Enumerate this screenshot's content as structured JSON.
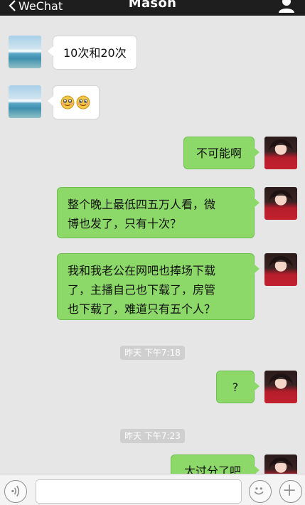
{
  "header": {
    "back_label": "WeChat",
    "title": "Mason",
    "bg_color": "#1e1e1e"
  },
  "messages": [
    {
      "side": "left",
      "avatar": "sea-avatar",
      "text": "10次和20次"
    },
    {
      "side": "left",
      "avatar": "sea-avatar",
      "text": "",
      "emoji": [
        "smiling-face-emoji",
        "smiling-face-emoji"
      ]
    },
    {
      "side": "right",
      "avatar": "girl-avatar",
      "text": "不可能啊"
    },
    {
      "side": "right",
      "avatar": "girl-avatar",
      "lines": [
        "整个晚上最低四五万人看，微",
        "博也发了，只有十次？"
      ]
    },
    {
      "side": "right",
      "avatar": "girl-avatar",
      "lines": [
        "我和我老公在网吧也捧场下载",
        "了，主播自己也下载了，房管",
        "也下载了，难道只有五个人？"
      ]
    },
    {
      "side": "right",
      "avatar": "girl-avatar",
      "text": "?"
    },
    {
      "side": "right",
      "avatar": "girl-avatar",
      "text": "太过分了吧"
    }
  ],
  "timestamps": [
    "昨天 下午7:18",
    "昨天 下午7:23"
  ],
  "colors": {
    "chat_bg": "#e6e6e6",
    "bubble_right": "#8cd96a",
    "bubble_left": "#ffffff"
  },
  "input": {
    "placeholder": ""
  },
  "icons": [
    "chevron-left-icon",
    "person-icon",
    "voice-icon",
    "emoji-face-icon",
    "plus-icon"
  ]
}
